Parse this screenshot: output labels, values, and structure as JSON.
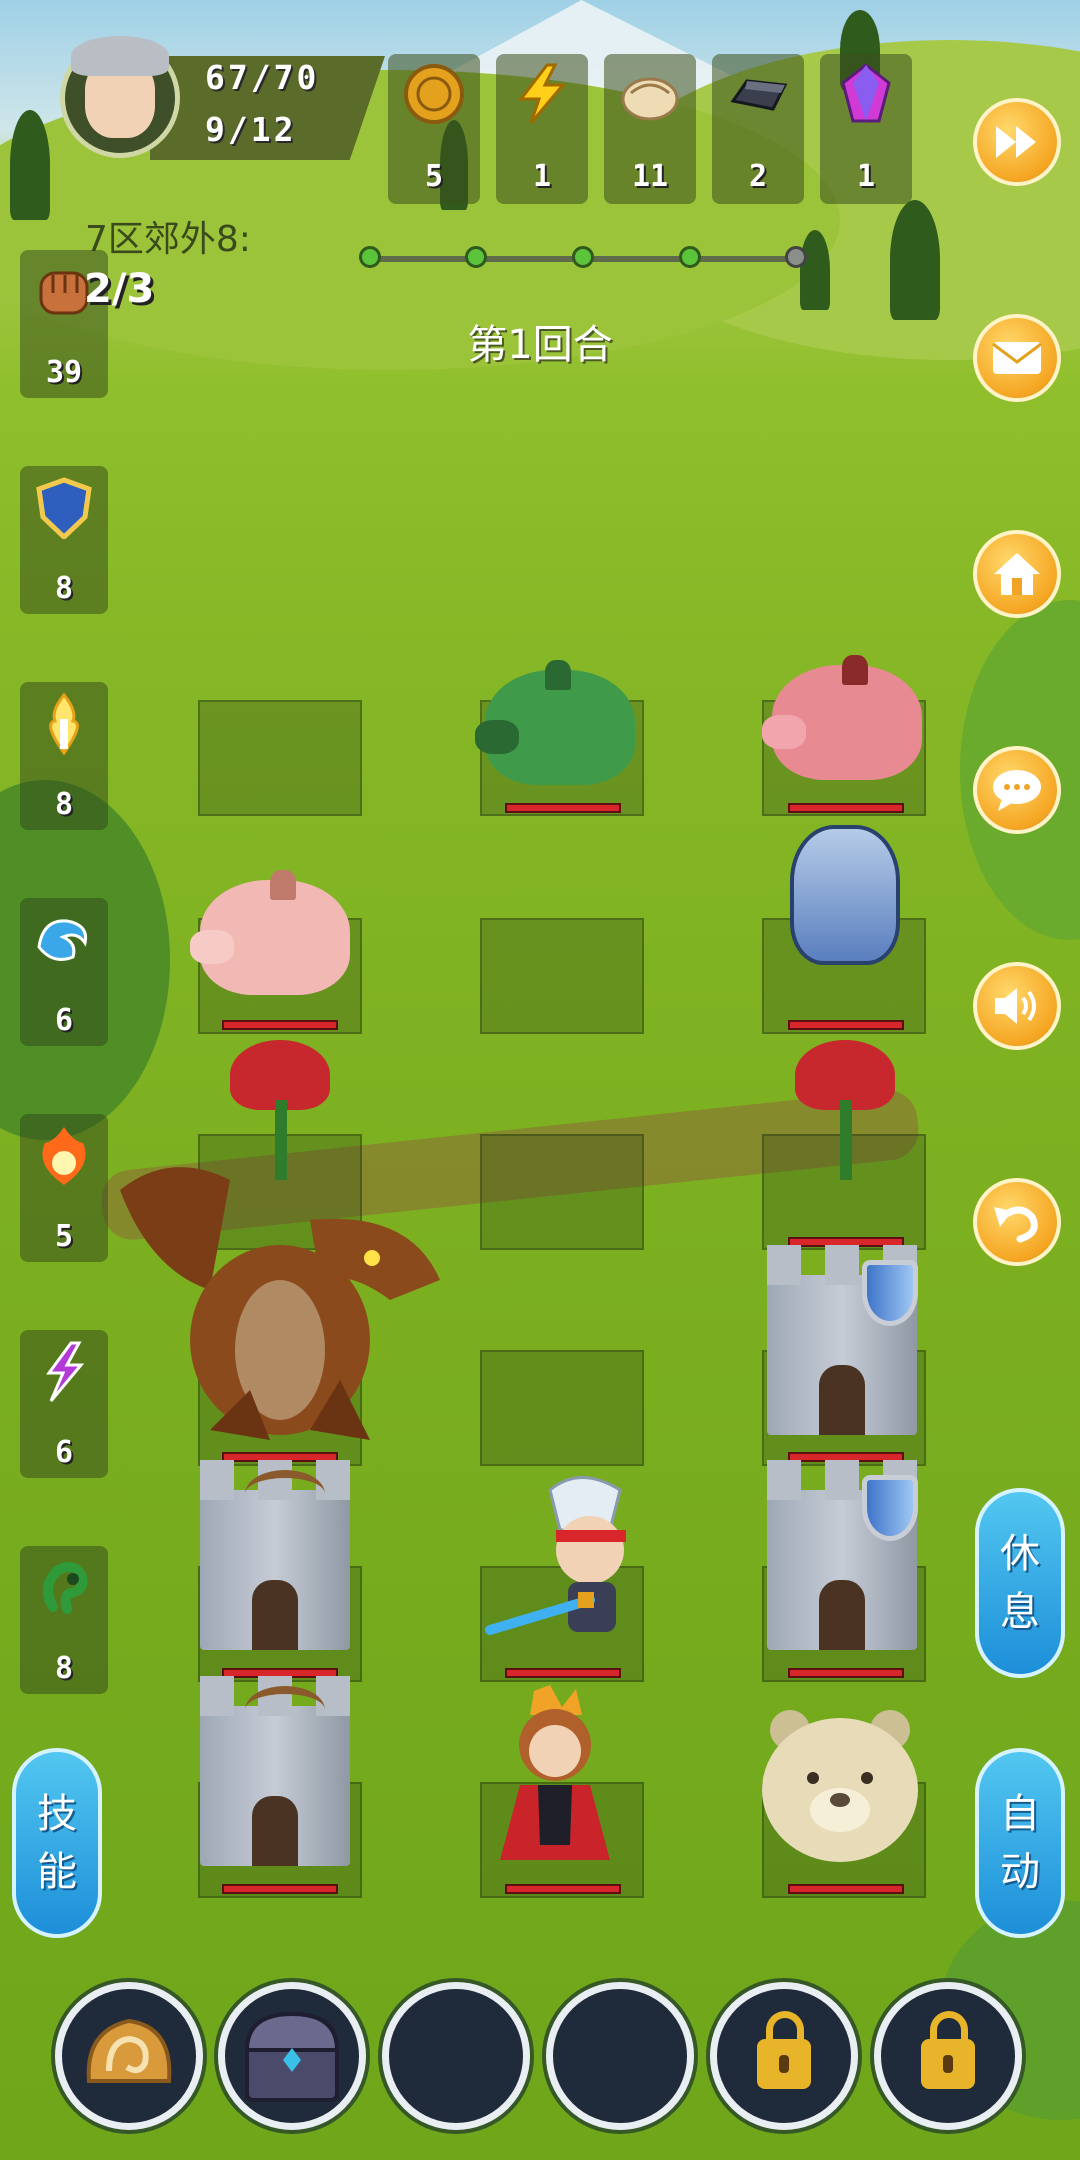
{
  "player": {
    "hp": "67/70",
    "stamina": "9/12"
  },
  "resources": [
    {
      "name": "coin-icon",
      "value": "5"
    },
    {
      "name": "lightning-icon",
      "value": "1"
    },
    {
      "name": "dumpling-icon",
      "value": "11"
    },
    {
      "name": "iron-ingot-icon",
      "value": "2"
    },
    {
      "name": "crystal-icon",
      "value": "1"
    }
  ],
  "stage": {
    "name": "7区郊外8:",
    "progress_total": 5,
    "progress_done": 4
  },
  "round_label": "第1回合",
  "fist": {
    "count": "2/3",
    "value": "39"
  },
  "skills": [
    {
      "name": "shield-skill-icon",
      "value": "8"
    },
    {
      "name": "holy-sword-skill-icon",
      "value": "8"
    },
    {
      "name": "water-skill-icon",
      "value": "6"
    },
    {
      "name": "fire-skill-icon",
      "value": "5"
    },
    {
      "name": "lightning-skill-icon",
      "value": "6"
    },
    {
      "name": "poison-skill-icon",
      "value": "8"
    }
  ],
  "side_buttons": [
    "fast-forward-icon",
    "mail-icon",
    "home-icon",
    "chat-icon",
    "sound-icon",
    "undo-icon"
  ],
  "buttons": {
    "rest": [
      "休",
      "息"
    ],
    "auto": [
      "自",
      "动"
    ],
    "skill": [
      "技",
      "能"
    ]
  },
  "colors": {
    "accent_orange": "#f5a623",
    "accent_blue": "#1d8fd9",
    "hp_red": "#d8262a"
  }
}
